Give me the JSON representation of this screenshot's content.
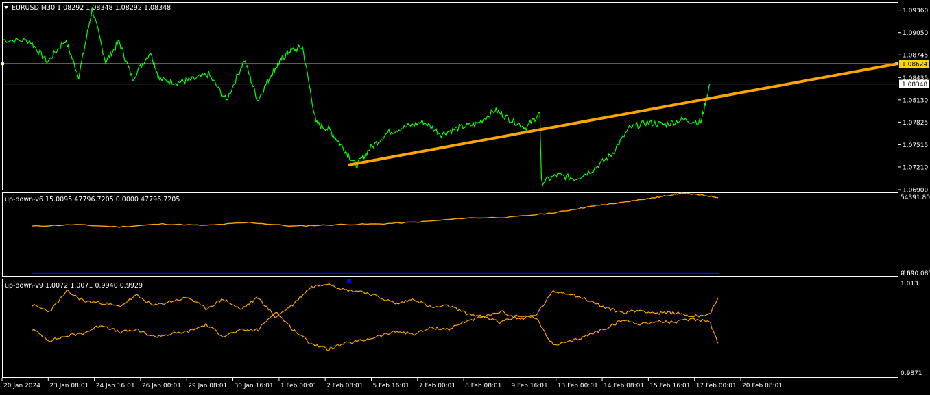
{
  "window": {
    "symbol_title": "EURUSD,M30",
    "ohlc": "1.08292 1.08348 1.08292 1.08348",
    "menu_icon": "triangle-down-icon"
  },
  "colors": {
    "background": "#000000",
    "frame": "#ffffff",
    "price_line": "#00ff00",
    "trendline": "#ffa500",
    "hline": "#ffff99",
    "hline_label_bg": "#ffd700",
    "current_price_line": "#808080",
    "indicator_line": "#ffa500",
    "blue_line": "#0000ff",
    "marker": "#0000ff"
  },
  "price_axis": {
    "ticks": [
      "1.09360",
      "1.09050",
      "1.08745",
      "1.08435",
      "1.08130",
      "1.07825",
      "1.07515",
      "1.07210",
      "1.06900"
    ],
    "hline_price_label": "1.08624",
    "current_price_label": "1.08348"
  },
  "sub1": {
    "title": "up-down-v6 15.0095 47796.7205 0.0000 47796.7205",
    "ticks": [
      "54391.802",
      "0.00",
      "-1690.085"
    ]
  },
  "sub2": {
    "title": "up-down-v9 1.0072 1.0071 0.9940 0.9929",
    "ticks": [
      "1.013",
      "0.9871"
    ]
  },
  "time_axis": {
    "labels": [
      "20 Jan 2024",
      "23 Jan 08:01",
      "24 Jan 16:01",
      "26 Jan 00:01",
      "29 Jan 08:01",
      "30 Jan 16:01",
      "1 Feb 00:01",
      "2 Feb 08:01",
      "5 Feb 16:01",
      "7 Feb 00:01",
      "8 Feb 08:01",
      "9 Feb 16:01",
      "13 Feb 00:01",
      "14 Feb 08:01",
      "15 Feb 16:01",
      "17 Feb 00:01",
      "20 Feb 08:01"
    ]
  },
  "chart_data": [
    {
      "type": "line",
      "name": "EURUSD,M30",
      "ylim": [
        1.069,
        1.0946
      ],
      "hline": 1.08624,
      "current": 1.08348,
      "trendline": {
        "start": {
          "x": 0.387,
          "y": 1.0724
        },
        "end": {
          "x": 0.998,
          "y": 1.0862
        }
      },
      "x": [
        0.0,
        0.03,
        0.05,
        0.07,
        0.085,
        0.1,
        0.115,
        0.13,
        0.145,
        0.165,
        0.175,
        0.195,
        0.21,
        0.23,
        0.25,
        0.27,
        0.285,
        0.3,
        0.31,
        0.32,
        0.335,
        0.35,
        0.365,
        0.38,
        0.395,
        0.41,
        0.43,
        0.45,
        0.47,
        0.49,
        0.51,
        0.53,
        0.55,
        0.567,
        0.585,
        0.6,
        0.602,
        0.62,
        0.64,
        0.66,
        0.68,
        0.7,
        0.72,
        0.74,
        0.76,
        0.78,
        0.79
      ],
      "y": [
        1.0895,
        1.0894,
        1.0865,
        1.0895,
        1.0845,
        1.0938,
        1.0865,
        1.0893,
        1.0842,
        1.0879,
        1.0841,
        1.0837,
        1.084,
        1.0848,
        1.0812,
        1.0868,
        1.0812,
        1.0848,
        1.0866,
        1.088,
        1.0885,
        1.0781,
        1.0772,
        1.0748,
        1.0723,
        1.0746,
        1.0768,
        1.0776,
        1.0783,
        1.0766,
        1.0775,
        1.078,
        1.0799,
        1.0786,
        1.0775,
        1.0795,
        1.07,
        1.071,
        1.0705,
        1.0718,
        1.0738,
        1.0774,
        1.0782,
        1.0779,
        1.0786,
        1.0782,
        1.0835
      ]
    },
    {
      "type": "line",
      "name": "up-down-v6",
      "ylim": [
        -1690.085,
        54391.802
      ],
      "x": [
        0.0,
        0.05,
        0.1,
        0.15,
        0.2,
        0.25,
        0.3,
        0.35,
        0.4,
        0.45,
        0.5,
        0.55,
        0.6,
        0.63,
        0.65,
        0.68,
        0.7,
        0.72,
        0.74,
        0.75,
        0.77,
        0.79
      ],
      "y": [
        32000,
        33000,
        31500,
        33500,
        32500,
        34500,
        32000,
        33000,
        33500,
        35000,
        37500,
        38000,
        41000,
        44000,
        46000,
        48000,
        50000,
        51500,
        53500,
        54300,
        53000,
        51500
      ],
      "blue": 0.0
    },
    {
      "type": "line",
      "name": "up-down-v9",
      "ylim": [
        0.9871,
        1.013
      ],
      "x": [
        0.0,
        0.02,
        0.04,
        0.06,
        0.08,
        0.1,
        0.12,
        0.14,
        0.16,
        0.18,
        0.2,
        0.22,
        0.24,
        0.26,
        0.28,
        0.3,
        0.32,
        0.34,
        0.36,
        0.38,
        0.4,
        0.42,
        0.44,
        0.46,
        0.48,
        0.5,
        0.52,
        0.54,
        0.56,
        0.58,
        0.6,
        0.62,
        0.64,
        0.66,
        0.68,
        0.7,
        0.72,
        0.74,
        0.76,
        0.78,
        0.79
      ],
      "series": [
        {
          "values": [
            1.0062,
            1.0045,
            1.0098,
            1.0072,
            1.0068,
            1.0058,
            1.0087,
            1.006,
            1.0072,
            1.0082,
            1.0052,
            1.0078,
            1.005,
            1.0082,
            1.003,
            1.0063,
            1.0108,
            1.012,
            1.0102,
            1.0098,
            1.0082,
            1.0065,
            1.0078,
            1.0055,
            1.006,
            1.004,
            1.003,
            1.0045,
            1.0025,
            1.0035,
            1.0098,
            1.0092,
            1.0075,
            1.0055,
            1.0042,
            1.0048,
            1.004,
            1.0042,
            1.0032,
            1.0038,
            1.0078
          ]
        },
        {
          "values": [
            0.9998,
            0.9968,
            0.998,
            0.9988,
            1.001,
            0.999,
            0.9996,
            0.9978,
            0.9985,
            0.9992,
            1.001,
            0.998,
            0.9995,
            0.9996,
            1.0045,
            0.9998,
            0.9962,
            0.9945,
            0.996,
            0.9968,
            0.998,
            0.9992,
            0.9985,
            1.0002,
            0.9998,
            1.002,
            1.003,
            1.0015,
            1.0035,
            1.0028,
            0.9955,
            0.9965,
            0.9982,
            1.0,
            1.0022,
            1.0012,
            1.0018,
            1.0016,
            1.0025,
            1.002,
            0.996
          ]
        }
      ],
      "marker": {
        "x": 0.387,
        "y": 1.0125
      }
    }
  ]
}
